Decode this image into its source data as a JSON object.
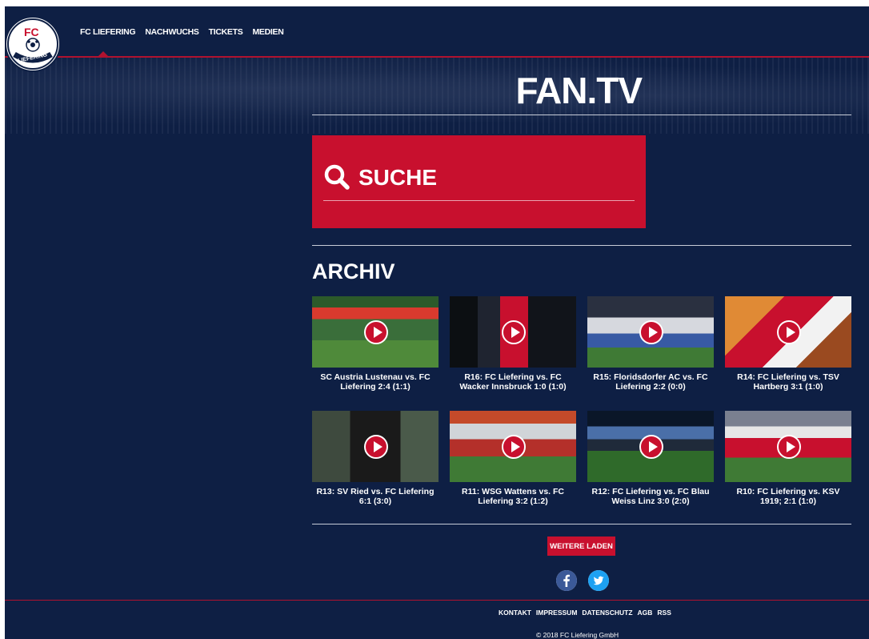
{
  "header": {
    "logo_text": "FC LIEFERING",
    "nav": [
      {
        "label": "FC LIEFERING"
      },
      {
        "label": "NACHWUCHS"
      },
      {
        "label": "TICKETS"
      },
      {
        "label": "MEDIEN"
      }
    ]
  },
  "page": {
    "title": "FAN.TV"
  },
  "search": {
    "label": "SUCHE",
    "icon": "search-icon"
  },
  "archive": {
    "title": "ARCHIV",
    "videos": [
      {
        "caption": "SC Austria Lustenau vs. FC Liefering 2:4 (1:1)"
      },
      {
        "caption": "R16: FC Liefering vs. FC Wacker Innsbruck 1:0 (1:0)"
      },
      {
        "caption": "R15: Floridsdorfer AC vs. FC Liefering 2:2 (0:0)"
      },
      {
        "caption": "R14: FC Liefering vs. TSV Hartberg 3:1 (1:0)"
      },
      {
        "caption": "R13: SV Ried vs. FC Liefering 6:1 (3:0)"
      },
      {
        "caption": "R11: WSG Wattens vs. FC Liefering 3:2 (1:2)"
      },
      {
        "caption": "R12: FC Liefering vs. FC Blau Weiss Linz 3:0 (2:0)"
      },
      {
        "caption": "R10: FC Liefering vs. KSV 1919; 2:1 (1:0)"
      }
    ],
    "load_more_label": "WEITERE LADEN"
  },
  "social": {
    "facebook_icon": "facebook-icon",
    "twitter_icon": "twitter-icon"
  },
  "footer": {
    "links": [
      {
        "label": "KONTAKT"
      },
      {
        "label": "IMPRESSUM"
      },
      {
        "label": "DATENSCHUTZ"
      },
      {
        "label": "AGB"
      },
      {
        "label": "RSS"
      }
    ],
    "copyright": "© 2018 FC Liefering GmbH"
  },
  "colors": {
    "background": "#0e1f44",
    "accent": "#c8102e"
  }
}
